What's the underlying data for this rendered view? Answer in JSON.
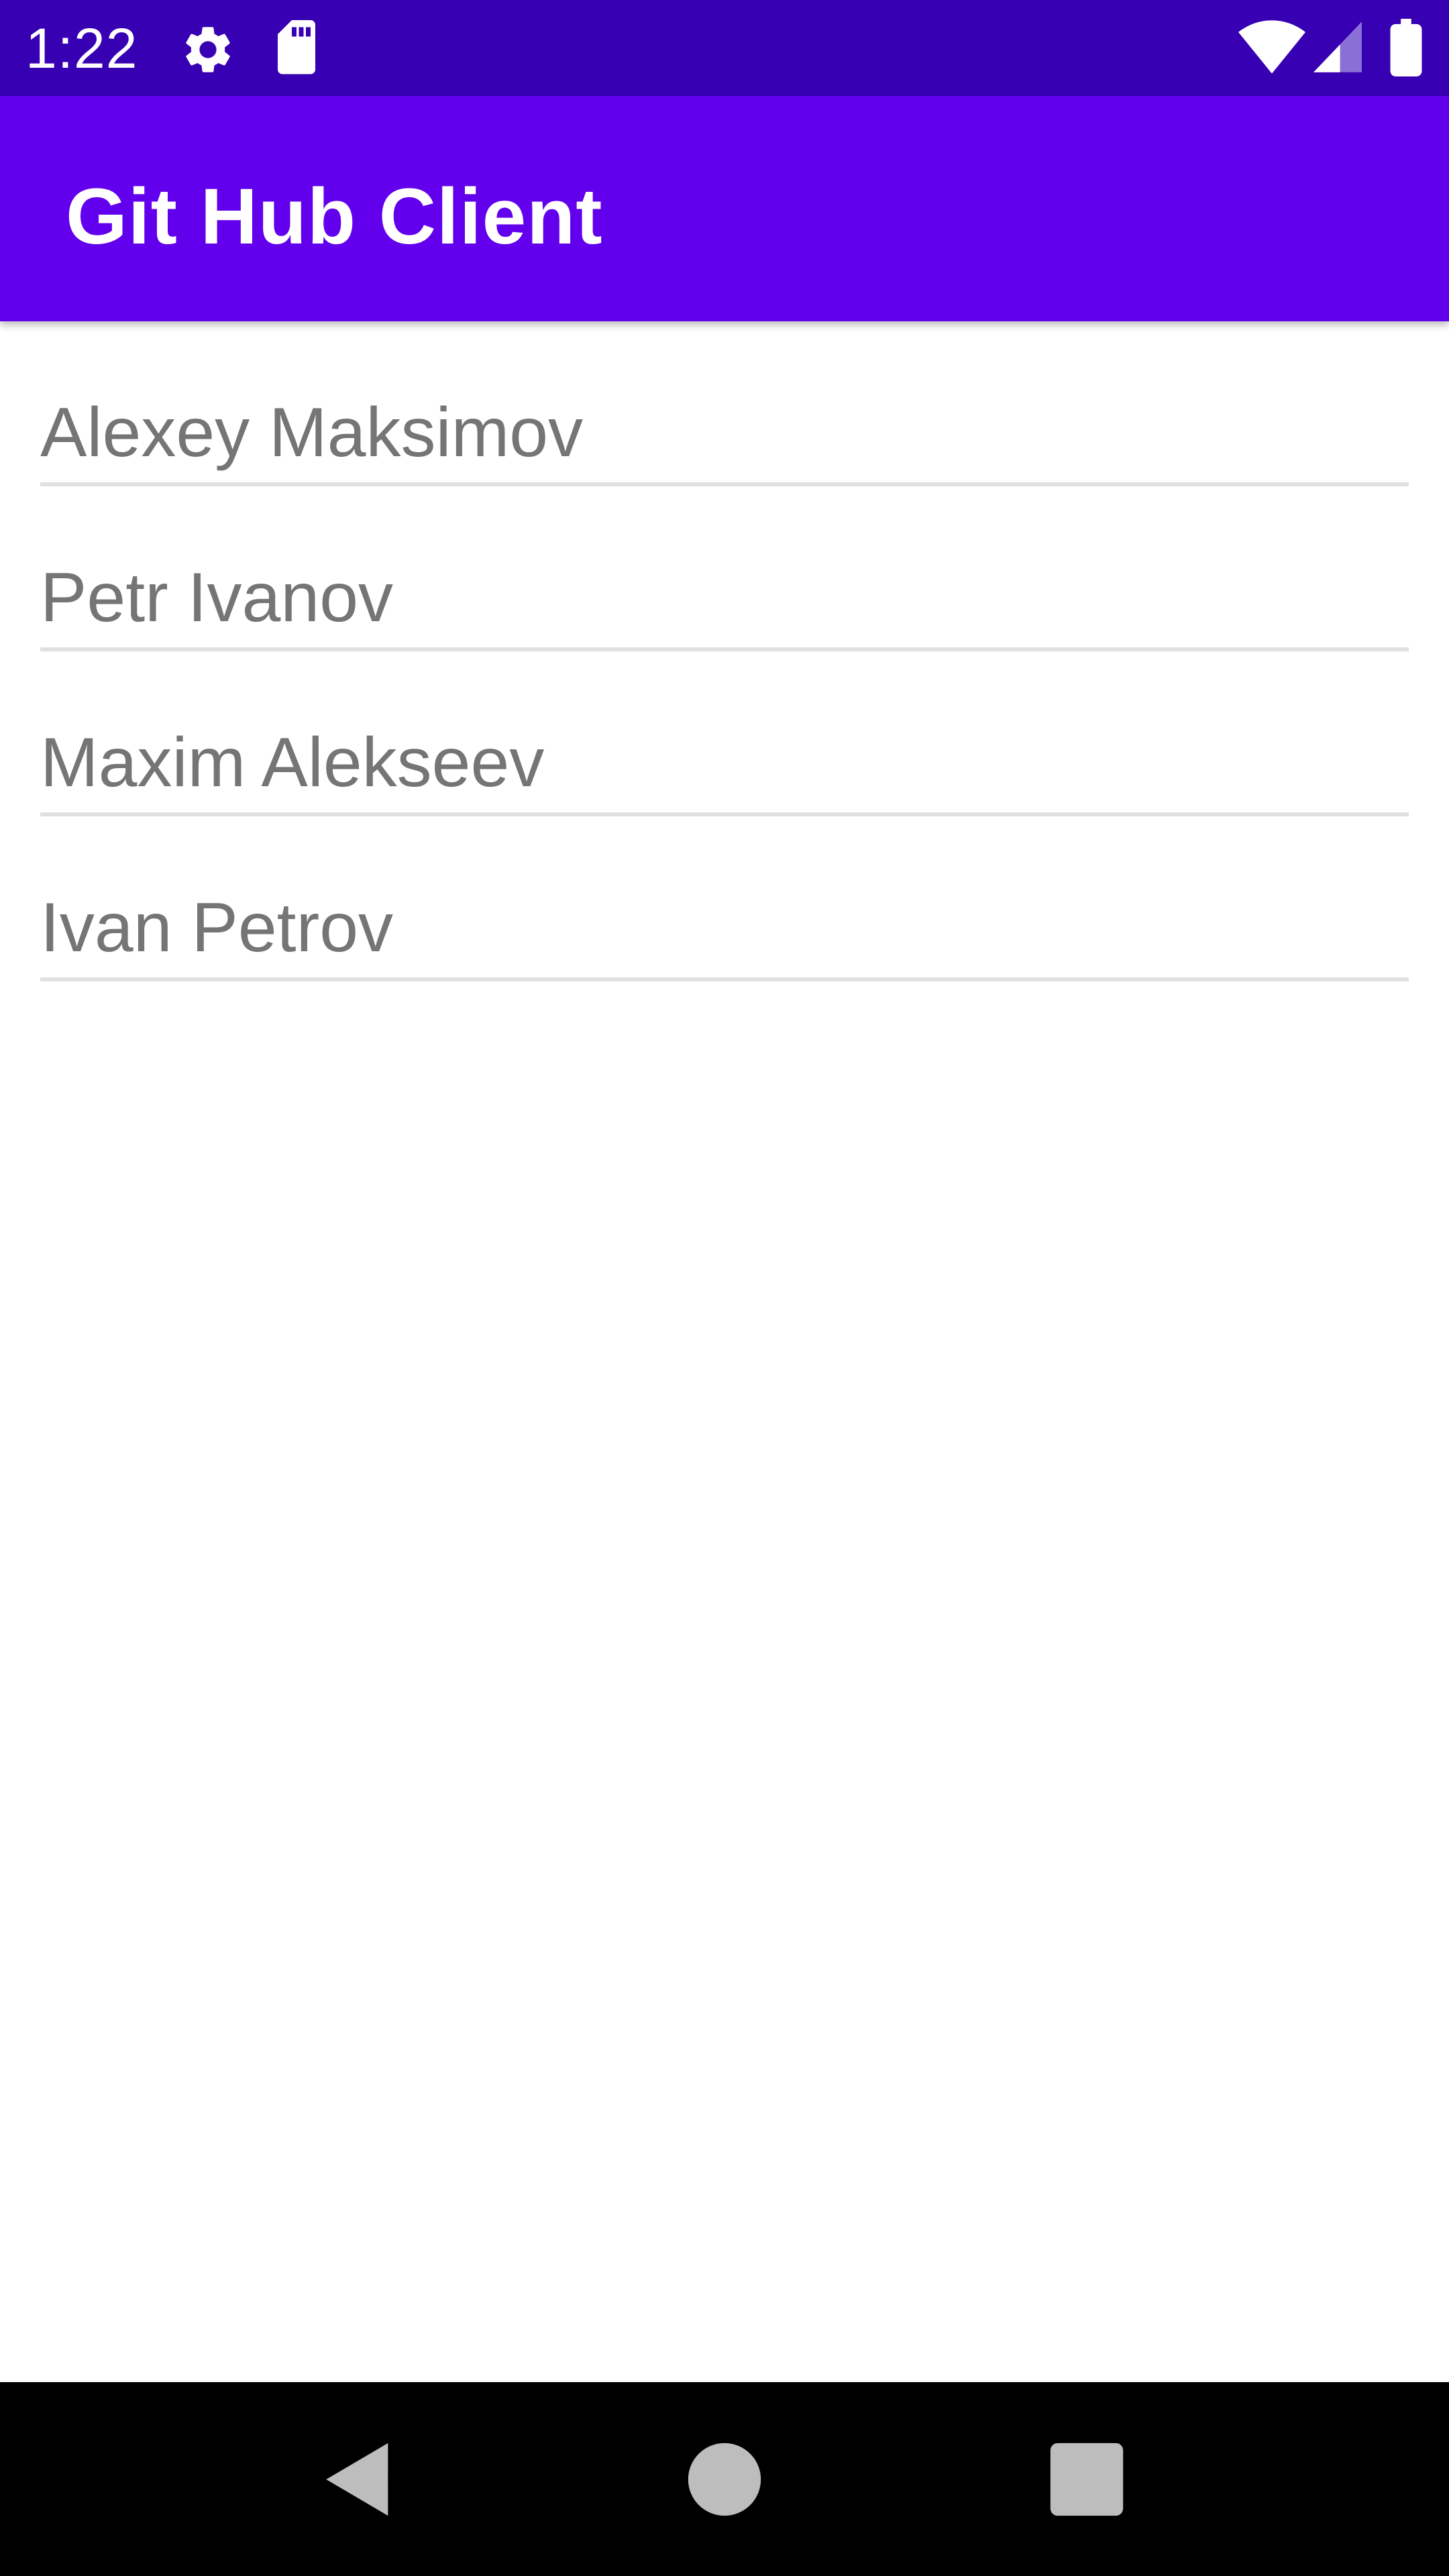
{
  "status_bar": {
    "time": "1:22",
    "icons": [
      "settings-icon",
      "sd-card-icon",
      "wifi-icon",
      "cellular-signal-icon",
      "battery-icon"
    ],
    "background": "#3700B3"
  },
  "app_bar": {
    "title": "Git Hub Client",
    "background": "#6200EE"
  },
  "users": [
    {
      "name": "Alexey Maksimov"
    },
    {
      "name": "Petr Ivanov"
    },
    {
      "name": "Maxim Alekseev"
    },
    {
      "name": "Ivan Petrov"
    }
  ],
  "nav_bar": {
    "buttons": [
      "back-icon",
      "home-icon",
      "recents-icon"
    ]
  }
}
